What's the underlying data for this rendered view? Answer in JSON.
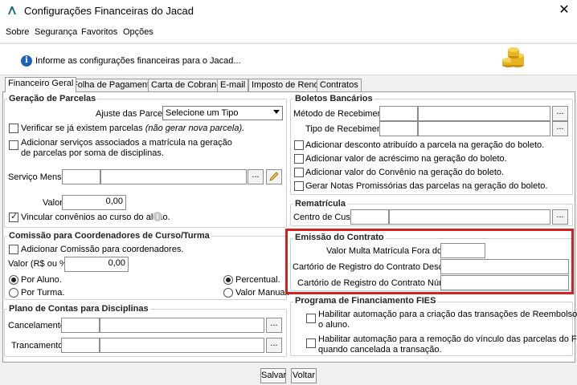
{
  "window": {
    "title": "Configurações Financeiras do Jacad",
    "close_glyph": "✕",
    "logo_glyph": "Λ"
  },
  "menu": [
    "Sobre",
    "Segurança",
    "Favoritos",
    "Opções"
  ],
  "info": {
    "icon": "info-icon",
    "text": "Informe as configurações financeiras para o Jacad..."
  },
  "tabs": [
    "Financeiro Geral",
    "Folha de Pagamento",
    "Carta de Cobrança",
    "E-mail",
    "Imposto de Renda",
    "Contratos"
  ],
  "geracao": {
    "title": "Geração de Parcelas",
    "ajuste_label": "Ajuste das Parcelas:",
    "ajuste_value": "Selecione um Tipo",
    "verificar": "Verificar se já existem parcelas",
    "verificar_note": "(não gerar nova parcela).",
    "adicionar_l1": "Adicionar serviços associados a matrícula na geração",
    "adicionar_l2": "de parcelas por soma de disciplinas.",
    "servico_label": "Serviço Mensal:",
    "valor_label": "Valor:",
    "valor_value": "0,00",
    "vincular": "Vincular convênios ao curso do aluno."
  },
  "comissao": {
    "title": "Comissão para Coordenadores de Curso/Turma",
    "adicionar": "Adicionar Comissão para coordenadores.",
    "valor_label": "Valor (R$ ou %):",
    "valor_value": "0,00",
    "por_aluno": "Por Aluno.",
    "por_turma": "Por Turma.",
    "percentual": "Percentual.",
    "valor_manual": "Valor Manual."
  },
  "plano": {
    "title": "Plano de Contas para Disciplinas",
    "cancelamento": "Cancelamento:",
    "trancamento": "Trancamento:"
  },
  "boletos": {
    "title": "Boletos Bancários",
    "metodo": "Método de Recebimento:",
    "tipo": "Tipo de Recebimento:",
    "opt1": "Adicionar desconto atribuído a parcela na geração do boleto.",
    "opt2": "Adicionar valor de acréscimo na geração do boleto.",
    "opt3": "Adicionar valor do Convênio na geração do boleto.",
    "opt4": "Gerar Notas Promissórias das parcelas na geração do boleto."
  },
  "rematricula": {
    "title": "Rematrícula",
    "centro": "Centro de Custo:"
  },
  "emissao": {
    "title": "Emissão do Contrato",
    "multa": "Valor Multa Matrícula Fora do Prazo:",
    "cartorio_desc": "Cartório de Registro do Contrato Descrição:",
    "cartorio_num": "Cartório de Registro do Contrato Número:"
  },
  "fies": {
    "title": "Programa de Financiamento FIES",
    "opt1_l1": "Habilitar automação para a criação das transações de Reembolso para",
    "opt1_l2": "o aluno.",
    "opt2_l1": "Habilitar automação para a remoção do vínculo das parcelas do FIES",
    "opt2_l2": "quando cancelada a transação."
  },
  "buttons": {
    "dots": "...",
    "salvar": "Salvar",
    "voltar": "Voltar"
  },
  "colors": {
    "highlight": "#d42020",
    "info_blue": "#1c62b9",
    "coin_gold": "#e8b320"
  }
}
